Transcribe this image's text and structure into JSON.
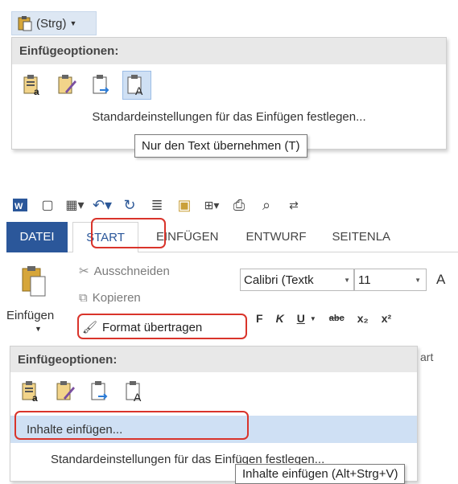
{
  "top_dropdown": {
    "ctrl_label": "(Strg)",
    "header": "Einfügeoptionen:",
    "options": [
      "keep-source-formatting-icon",
      "merge-formatting-icon",
      "picture-paste-icon",
      "text-only-icon"
    ],
    "menu_item": "Standardeinstellungen für das Einfügen festlegen...",
    "tooltip": "Nur den Text übernehmen (T)"
  },
  "word": {
    "tabs": [
      "DATEI",
      "START",
      "EINFÜGEN",
      "ENTWURF",
      "SEITENLA"
    ],
    "clipboard": {
      "paste_label": "Einfügen",
      "cut": "Ausschneiden",
      "copy": "Kopieren",
      "format_painter": "Format übertragen"
    },
    "font": {
      "name": "Calibri (Textk",
      "size": "11",
      "partial_letter": "A",
      "format_buttons": [
        "F",
        "K",
        "U",
        "abc",
        "x₂",
        "x²"
      ]
    },
    "group_label_partial": "art",
    "paste_menu": {
      "header": "Einfügeoptionen:",
      "items": [
        "Inhalte einfügen...",
        "Standardeinstellungen für das Einfügen festlegen..."
      ]
    },
    "tooltip": "Inhalte einfügen (Alt+Strg+V)"
  },
  "colors": {
    "accent_blue": "#2b579a",
    "highlight_red": "#d9342b",
    "selection_blue": "#cfe0f4",
    "menu_header_gray": "#e8e8e8"
  }
}
